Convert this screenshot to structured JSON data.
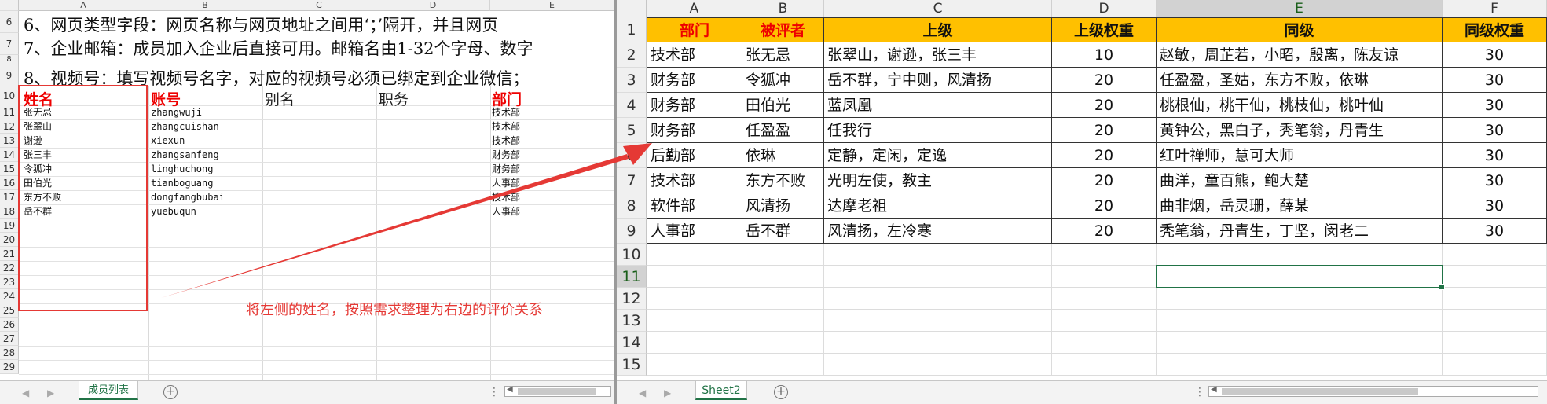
{
  "left_sheet": {
    "col_headers": [
      "A",
      "B",
      "C",
      "D",
      "E"
    ],
    "notes": [
      {
        "row": "6",
        "text": "6、网页类型字段：网页名称与网页地址之间用‘；’隔开，并且网页"
      },
      {
        "row": "7",
        "text": "7、企业邮箱：成员加入企业后直接可用。邮箱名由1-32个字母、数字"
      },
      {
        "row": "9",
        "text": "8、视频号：填写视频号名字，对应的视频号必须已绑定到企业微信；"
      }
    ],
    "note_row_numbers": [
      "6",
      "7",
      "8",
      "9"
    ],
    "headers": {
      "name": "姓名",
      "account": "账号",
      "alias": "别名",
      "title": "职务",
      "dept": "部门"
    },
    "rows": [
      {
        "num": "11",
        "name": "张无忌",
        "account": "zhangwuji",
        "dept": "技术部"
      },
      {
        "num": "12",
        "name": "张翠山",
        "account": "zhangcuishan",
        "dept": "技术部"
      },
      {
        "num": "13",
        "name": "谢逊",
        "account": "xiexun",
        "dept": "技术部"
      },
      {
        "num": "14",
        "name": "张三丰",
        "account": "zhangsanfeng",
        "dept": "财务部"
      },
      {
        "num": "15",
        "name": "令狐冲",
        "account": "linghuchong",
        "dept": "财务部"
      },
      {
        "num": "16",
        "name": "田伯光",
        "account": "tianboguang",
        "dept": "人事部"
      },
      {
        "num": "17",
        "name": "东方不败",
        "account": "dongfangbubai",
        "dept": "技术部"
      },
      {
        "num": "18",
        "name": "岳不群",
        "account": "yuebuqun",
        "dept": "人事部"
      }
    ],
    "empty_rows": [
      "19",
      "20",
      "21",
      "22",
      "23",
      "24",
      "25",
      "26",
      "27",
      "28",
      "29"
    ],
    "header_row_number": "10",
    "sheet_tab": "成员列表",
    "annotation": "将左侧的姓名，按照需求整理为右边的评价关系"
  },
  "right_sheet": {
    "col_headers": [
      "A",
      "B",
      "C",
      "D",
      "E",
      "F"
    ],
    "header_row": {
      "num": "1",
      "dept": "部门",
      "reviewee": "被评者",
      "superior": "上级",
      "superior_weight": "上级权重",
      "peers": "同级",
      "peer_weight": "同级权重"
    },
    "rows": [
      {
        "num": "2",
        "dept": "技术部",
        "reviewee": "张无忌",
        "superior": "张翠山，谢逊，张三丰",
        "superior_weight": "10",
        "peers": "赵敏，周芷若，小昭，殷离，陈友谅",
        "peer_weight": "30"
      },
      {
        "num": "3",
        "dept": "财务部",
        "reviewee": "令狐冲",
        "superior": "岳不群，宁中则，风清扬",
        "superior_weight": "20",
        "peers": "任盈盈，圣姑，东方不败，依琳",
        "peer_weight": "30"
      },
      {
        "num": "4",
        "dept": "财务部",
        "reviewee": "田伯光",
        "superior": "蓝凤凰",
        "superior_weight": "20",
        "peers": "桃根仙，桃干仙，桃枝仙，桃叶仙",
        "peer_weight": "30"
      },
      {
        "num": "5",
        "dept": "财务部",
        "reviewee": "任盈盈",
        "superior": "任我行",
        "superior_weight": "20",
        "peers": "黄钟公，黑白子，秃笔翁，丹青生",
        "peer_weight": "30"
      },
      {
        "num": "6",
        "dept": "后勤部",
        "reviewee": "依琳",
        "superior": "定静，定闲，定逸",
        "superior_weight": "20",
        "peers": "红叶禅师，慧可大师",
        "peer_weight": "30"
      },
      {
        "num": "7",
        "dept": "技术部",
        "reviewee": "东方不败",
        "superior": "光明左使，教主",
        "superior_weight": "20",
        "peers": "曲洋，童百熊，鲍大楚",
        "peer_weight": "30"
      },
      {
        "num": "8",
        "dept": "软件部",
        "reviewee": "风清扬",
        "superior": "达摩老祖",
        "superior_weight": "20",
        "peers": "曲非烟，岳灵珊，薛某",
        "peer_weight": "30"
      },
      {
        "num": "9",
        "dept": "人事部",
        "reviewee": "岳不群",
        "superior": "风清扬，左冷寒",
        "superior_weight": "20",
        "peers": "秃笔翁，丹青生，丁坚，闵老二",
        "peer_weight": "30"
      }
    ],
    "empty_rows": [
      "10",
      "11",
      "12",
      "13",
      "14",
      "15"
    ],
    "selected_cell": "E11",
    "sheet_tab": "Sheet2"
  },
  "icons": {
    "add_sheet": "plus-circle-icon",
    "scroll_left": "arrow-left-icon",
    "scroll_right": "arrow-right-icon"
  },
  "colors": {
    "header_fill": "#ffc000",
    "red_text": "#e00000",
    "annotation_red": "#e53935",
    "excel_green": "#217346"
  }
}
